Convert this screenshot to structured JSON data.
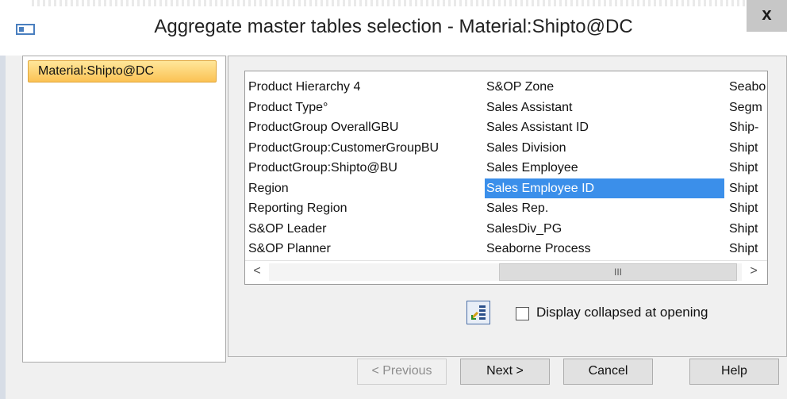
{
  "window": {
    "title": "Aggregate master tables selection - Material:Shipto@DC",
    "close_label": "x"
  },
  "left_panel": {
    "selected_item": "Material:Shipto@DC"
  },
  "list": {
    "column1": [
      "Product Hierarchy 4",
      "Product Type°",
      "ProductGroup OverallGBU",
      "ProductGroup:CustomerGroupBU",
      "ProductGroup:Shipto@BU",
      "Region",
      "Reporting Region",
      "S&OP Leader",
      "S&OP Planner"
    ],
    "column2": [
      "S&OP Zone",
      "Sales Assistant",
      "Sales Assistant ID",
      "Sales Division",
      "Sales Employee",
      "Sales Employee ID",
      "Sales Rep.",
      "SalesDiv_PG",
      "Seaborne Process"
    ],
    "column3": [
      "Seabo",
      "Segm",
      "Ship-",
      "Shipt",
      "Shipt",
      "Shipt",
      "Shipt",
      "Shipt",
      "Shipt"
    ],
    "selected_item": "Sales Employee ID",
    "selection_color": "#3b8fea",
    "scroll_left": "<",
    "scroll_right": ">",
    "scroll_thumb_label": "III"
  },
  "options": {
    "display_collapsed_label": "Display collapsed at opening",
    "display_collapsed_checked": false,
    "expand_icon": "tree-expand-icon"
  },
  "buttons": {
    "previous": "< Previous",
    "next": "Next >",
    "cancel": "Cancel",
    "help": "Help"
  },
  "colors": {
    "selected_master_bg": "#fbc254",
    "window_bg": "#f0f0f0"
  }
}
